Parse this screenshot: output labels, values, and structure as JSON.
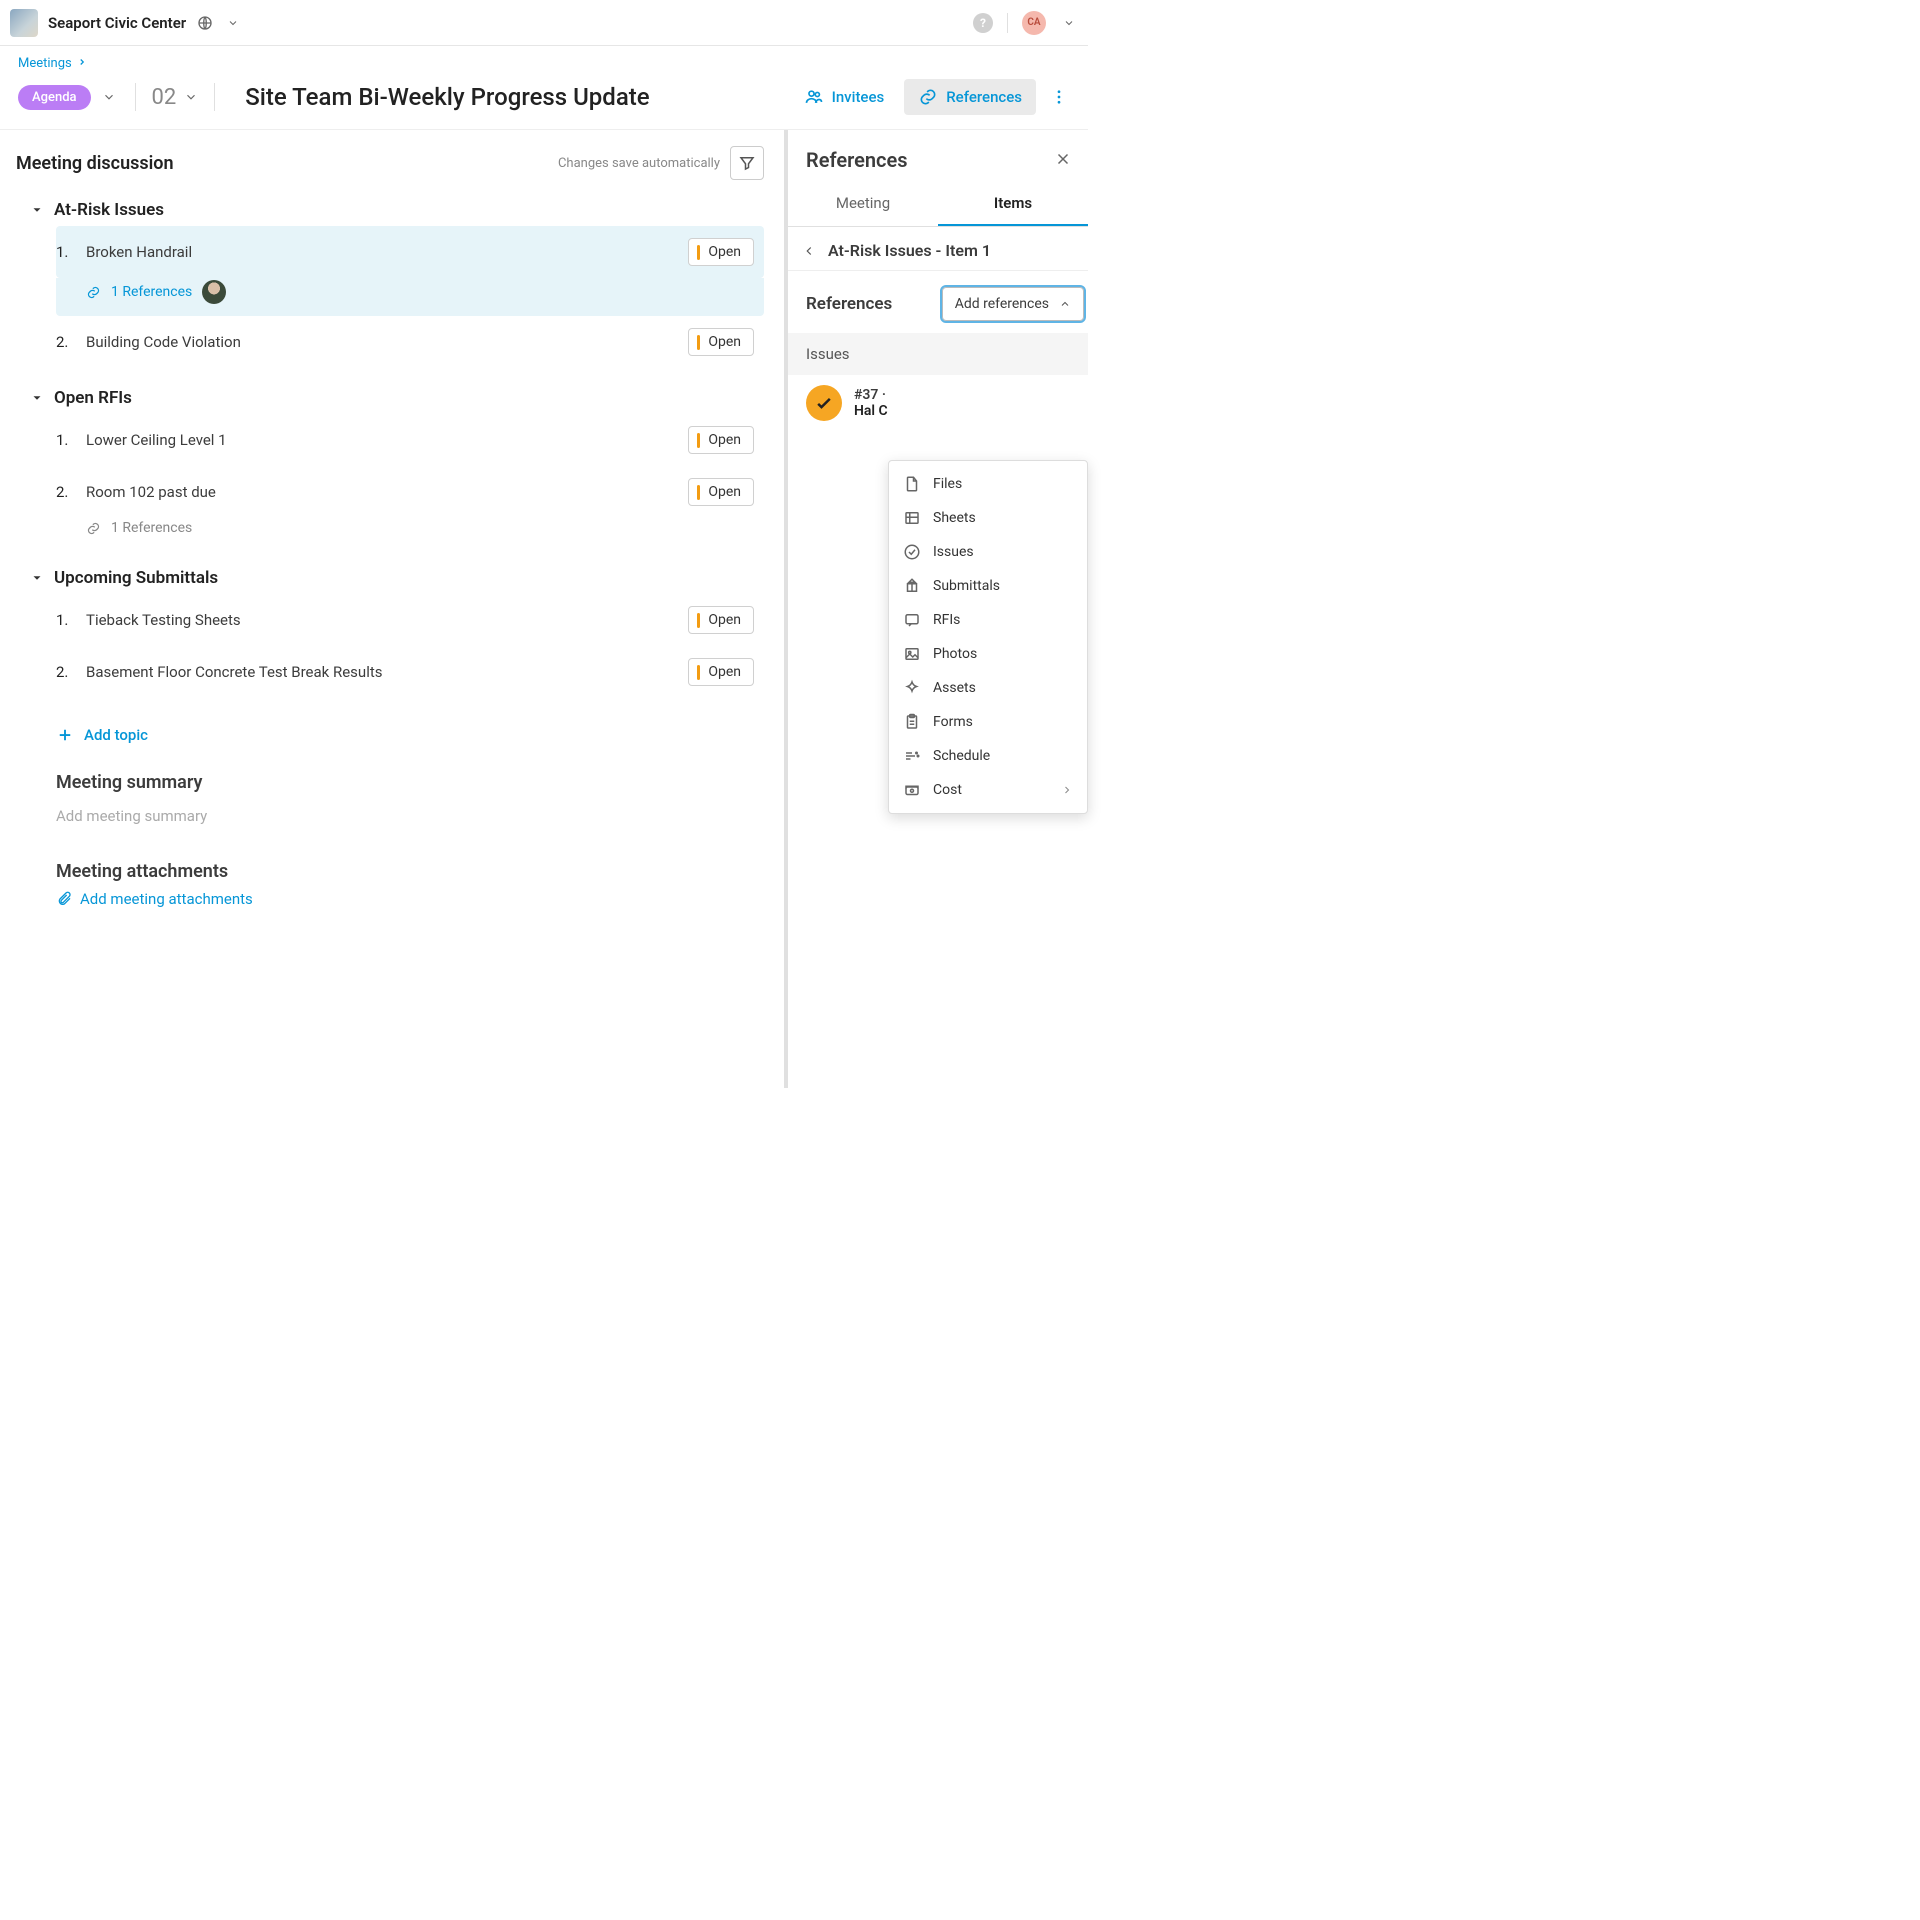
{
  "topbar": {
    "project_name": "Seaport Civic Center",
    "avatar_initials": "CA"
  },
  "breadcrumb": {
    "meetings": "Meetings"
  },
  "header": {
    "agenda_chip": "Agenda",
    "meeting_number": "02",
    "meeting_title": "Site Team Bi-Weekly Progress Update",
    "invitees": "Invitees",
    "references": "References"
  },
  "discussion": {
    "title": "Meeting discussion",
    "autosave": "Changes save automatically",
    "open_label": "Open",
    "add_topic": "Add topic",
    "topics": [
      {
        "name": "At-Risk Issues",
        "items": [
          {
            "num": "1.",
            "title": "Broken Handrail",
            "selected": true,
            "ref_count": "1 References",
            "has_avatar": true
          },
          {
            "num": "2.",
            "title": "Building Code Violation"
          }
        ]
      },
      {
        "name": "Open RFIs",
        "items": [
          {
            "num": "1.",
            "title": "Lower Ceiling Level 1"
          },
          {
            "num": "2.",
            "title": "Room 102 past due",
            "ref_count": "1 References",
            "muted_ref": true
          }
        ]
      },
      {
        "name": "Upcoming Submittals",
        "items": [
          {
            "num": "1.",
            "title": "Tieback Testing Sheets"
          },
          {
            "num": "2.",
            "title": "Basement Floor Concrete Test Break Results"
          }
        ]
      }
    ],
    "summary_title": "Meeting summary",
    "summary_placeholder": "Add meeting summary",
    "attachments_title": "Meeting attachments",
    "attachments_link": "Add meeting attachments"
  },
  "panel": {
    "title": "References",
    "tab_meeting": "Meeting",
    "tab_items": "Items",
    "sub_title": "At-Risk Issues - Item 1",
    "refs_label": "References",
    "add_ref": "Add references",
    "issues_header": "Issues",
    "issue_line1": "#37 ·",
    "issue_line2": "Hal C",
    "dropdown": {
      "files": "Files",
      "sheets": "Sheets",
      "issues": "Issues",
      "submittals": "Submittals",
      "rfis": "RFIs",
      "photos": "Photos",
      "assets": "Assets",
      "forms": "Forms",
      "schedule": "Schedule",
      "cost": "Cost"
    }
  }
}
